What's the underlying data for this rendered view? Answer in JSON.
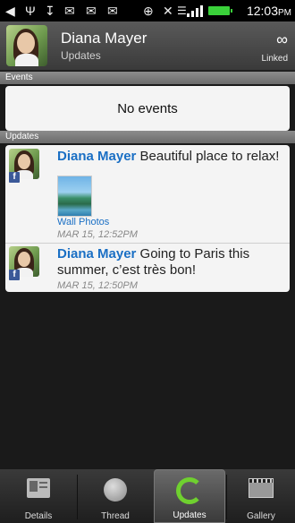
{
  "status_bar": {
    "time": "12:03",
    "ampm": "PM",
    "icons": [
      "navigation-icon",
      "usb-icon",
      "download-icon",
      "mail-icon",
      "mail-icon",
      "gmail-icon",
      "gps-icon",
      "bluetooth-icon",
      "wifi-icon",
      "signal-icon",
      "battery-icon"
    ]
  },
  "header": {
    "name": "Diana Mayer",
    "subtitle": "Updates",
    "linked_label": "Linked"
  },
  "events": {
    "section_title": "Events",
    "empty_text": "No events"
  },
  "updates": {
    "section_title": "Updates",
    "items": [
      {
        "author": "Diana Mayer",
        "text": " Beautiful place to relax!",
        "attachment_label": "Wall Photos",
        "timestamp": "MAR 15, 12:52PM"
      },
      {
        "author": "Diana Mayer",
        "text": " Going to Paris this summer, c’est très bon!",
        "timestamp": "MAR 15, 12:50PM"
      }
    ]
  },
  "tabs": [
    {
      "label": "Details",
      "icon": "details-icon"
    },
    {
      "label": "Thread",
      "icon": "thread-icon"
    },
    {
      "label": "Updates",
      "icon": "updates-icon",
      "active": true
    },
    {
      "label": "Gallery",
      "icon": "gallery-icon"
    }
  ],
  "colors": {
    "accent_link": "#1a6fc4",
    "battery": "#3ad13a",
    "facebook": "#3b5998"
  }
}
